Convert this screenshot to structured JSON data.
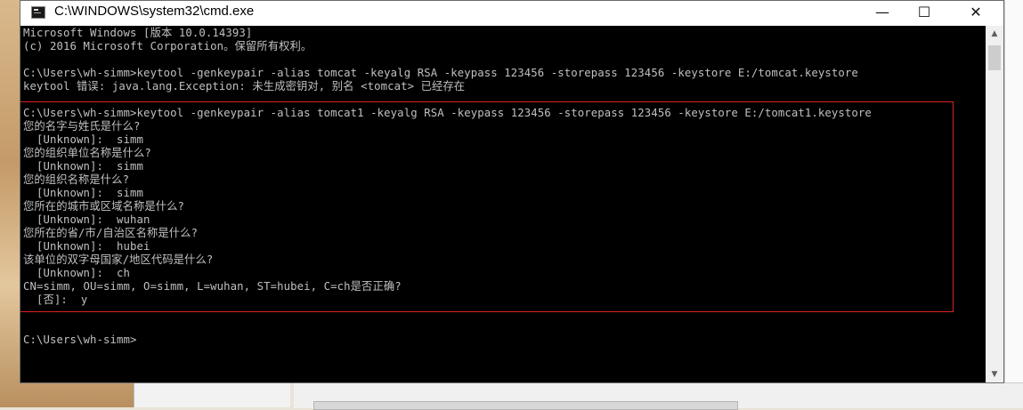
{
  "window": {
    "title": "C:\\WINDOWS\\system32\\cmd.exe",
    "minimize_glyph": "—",
    "maximize_glyph": "☐",
    "close_glyph": "✕"
  },
  "console": {
    "lines": [
      "Microsoft Windows [版本 10.0.14393]",
      "(c) 2016 Microsoft Corporation。保留所有权利。",
      "",
      "C:\\Users\\wh-simm>keytool -genkeypair -alias tomcat -keyalg RSA -keypass 123456 -storepass 123456 -keystore E:/tomcat.keystore",
      "keytool 错误: java.lang.Exception: 未生成密钥对, 别名 <tomcat> 已经存在",
      "",
      "C:\\Users\\wh-simm>keytool -genkeypair -alias tomcat1 -keyalg RSA -keypass 123456 -storepass 123456 -keystore E:/tomcat1.keystore",
      "您的名字与姓氏是什么?",
      "  [Unknown]:  simm",
      "您的组织单位名称是什么?",
      "  [Unknown]:  simm",
      "您的组织名称是什么?",
      "  [Unknown]:  simm",
      "您所在的城市或区域名称是什么?",
      "  [Unknown]:  wuhan",
      "您所在的省/市/自治区名称是什么?",
      "  [Unknown]:  hubei",
      "该单位的双字母国家/地区代码是什么?",
      "  [Unknown]:  ch",
      "CN=simm, OU=simm, O=simm, L=wuhan, ST=hubei, C=ch是否正确?",
      "  [否]:  y",
      "",
      "",
      "C:\\Users\\wh-simm>"
    ]
  },
  "scrollbar": {
    "up_glyph": "▲",
    "down_glyph": "▼"
  },
  "colors": {
    "console_bg": "#000000",
    "console_text": "#c0c0c0",
    "highlight_border": "#e02020"
  }
}
